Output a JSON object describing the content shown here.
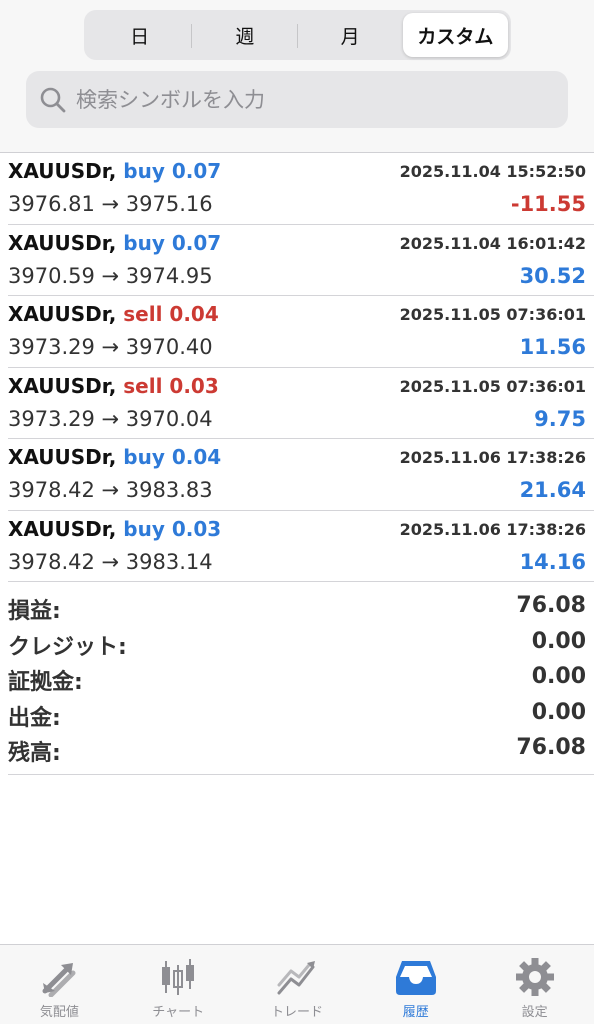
{
  "period_tabs": [
    {
      "label": "日",
      "active": false
    },
    {
      "label": "週",
      "active": false
    },
    {
      "label": "月",
      "active": false
    },
    {
      "label": "カスタム",
      "active": true
    }
  ],
  "search": {
    "placeholder": "検索シンボルを入力",
    "icon": "search-icon"
  },
  "trades": [
    {
      "symbol": "XAUUSDr,",
      "side": "buy",
      "volume": "buy 0.07",
      "datetime": "2025.11.04 15:52:50",
      "prices": "3976.81 → 3975.16",
      "profit": "-11.55"
    },
    {
      "symbol": "XAUUSDr,",
      "side": "buy",
      "volume": "buy 0.07",
      "datetime": "2025.11.04 16:01:42",
      "prices": "3970.59 → 3974.95",
      "profit": "30.52"
    },
    {
      "symbol": "XAUUSDr,",
      "side": "sell",
      "volume": "sell 0.04",
      "datetime": "2025.11.05 07:36:01",
      "prices": "3973.29 → 3970.40",
      "profit": "11.56"
    },
    {
      "symbol": "XAUUSDr,",
      "side": "sell",
      "volume": "sell 0.03",
      "datetime": "2025.11.05 07:36:01",
      "prices": "3973.29 → 3970.04",
      "profit": "9.75"
    },
    {
      "symbol": "XAUUSDr,",
      "side": "buy",
      "volume": "buy 0.04",
      "datetime": "2025.11.06 17:38:26",
      "prices": "3978.42 → 3983.83",
      "profit": "21.64"
    },
    {
      "symbol": "XAUUSDr,",
      "side": "buy",
      "volume": "buy 0.03",
      "datetime": "2025.11.06 17:38:26",
      "prices": "3978.42 → 3983.14",
      "profit": "14.16"
    }
  ],
  "summary": [
    {
      "label": "損益:",
      "value": "76.08"
    },
    {
      "label": "クレジット:",
      "value": "0.00"
    },
    {
      "label": "証拠金:",
      "value": "0.00"
    },
    {
      "label": "出金:",
      "value": "0.00"
    },
    {
      "label": "残高:",
      "value": "76.08"
    }
  ],
  "bottom_tabs": [
    {
      "label": "気配値",
      "icon": "quotes-arrows-icon",
      "active": false
    },
    {
      "label": "チャート",
      "icon": "candlestick-chart-icon",
      "active": false
    },
    {
      "label": "トレード",
      "icon": "trade-trend-icon",
      "active": false
    },
    {
      "label": "履歴",
      "icon": "inbox-tray-icon",
      "active": true
    },
    {
      "label": "設定",
      "icon": "gear-icon",
      "active": false
    }
  ],
  "colors": {
    "buy": "#2e7ad8",
    "sell": "#cc3a33",
    "positive": "#2e7ad8",
    "negative": "#cc3a33",
    "active_tab": "#2e7ad8",
    "inactive_tab": "#8e8e93"
  }
}
